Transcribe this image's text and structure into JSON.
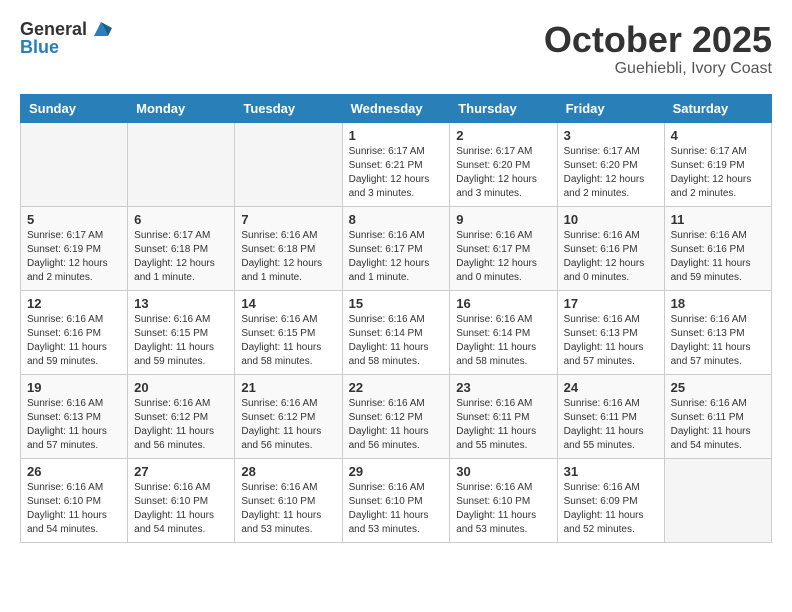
{
  "header": {
    "logo_general": "General",
    "logo_blue": "Blue",
    "month": "October 2025",
    "location": "Guehiebli, Ivory Coast"
  },
  "weekdays": [
    "Sunday",
    "Monday",
    "Tuesday",
    "Wednesday",
    "Thursday",
    "Friday",
    "Saturday"
  ],
  "weeks": [
    [
      {
        "day": "",
        "info": ""
      },
      {
        "day": "",
        "info": ""
      },
      {
        "day": "",
        "info": ""
      },
      {
        "day": "1",
        "info": "Sunrise: 6:17 AM\nSunset: 6:21 PM\nDaylight: 12 hours\nand 3 minutes."
      },
      {
        "day": "2",
        "info": "Sunrise: 6:17 AM\nSunset: 6:20 PM\nDaylight: 12 hours\nand 3 minutes."
      },
      {
        "day": "3",
        "info": "Sunrise: 6:17 AM\nSunset: 6:20 PM\nDaylight: 12 hours\nand 2 minutes."
      },
      {
        "day": "4",
        "info": "Sunrise: 6:17 AM\nSunset: 6:19 PM\nDaylight: 12 hours\nand 2 minutes."
      }
    ],
    [
      {
        "day": "5",
        "info": "Sunrise: 6:17 AM\nSunset: 6:19 PM\nDaylight: 12 hours\nand 2 minutes."
      },
      {
        "day": "6",
        "info": "Sunrise: 6:17 AM\nSunset: 6:18 PM\nDaylight: 12 hours\nand 1 minute."
      },
      {
        "day": "7",
        "info": "Sunrise: 6:16 AM\nSunset: 6:18 PM\nDaylight: 12 hours\nand 1 minute."
      },
      {
        "day": "8",
        "info": "Sunrise: 6:16 AM\nSunset: 6:17 PM\nDaylight: 12 hours\nand 1 minute."
      },
      {
        "day": "9",
        "info": "Sunrise: 6:16 AM\nSunset: 6:17 PM\nDaylight: 12 hours\nand 0 minutes."
      },
      {
        "day": "10",
        "info": "Sunrise: 6:16 AM\nSunset: 6:16 PM\nDaylight: 12 hours\nand 0 minutes."
      },
      {
        "day": "11",
        "info": "Sunrise: 6:16 AM\nSunset: 6:16 PM\nDaylight: 11 hours\nand 59 minutes."
      }
    ],
    [
      {
        "day": "12",
        "info": "Sunrise: 6:16 AM\nSunset: 6:16 PM\nDaylight: 11 hours\nand 59 minutes."
      },
      {
        "day": "13",
        "info": "Sunrise: 6:16 AM\nSunset: 6:15 PM\nDaylight: 11 hours\nand 59 minutes."
      },
      {
        "day": "14",
        "info": "Sunrise: 6:16 AM\nSunset: 6:15 PM\nDaylight: 11 hours\nand 58 minutes."
      },
      {
        "day": "15",
        "info": "Sunrise: 6:16 AM\nSunset: 6:14 PM\nDaylight: 11 hours\nand 58 minutes."
      },
      {
        "day": "16",
        "info": "Sunrise: 6:16 AM\nSunset: 6:14 PM\nDaylight: 11 hours\nand 58 minutes."
      },
      {
        "day": "17",
        "info": "Sunrise: 6:16 AM\nSunset: 6:13 PM\nDaylight: 11 hours\nand 57 minutes."
      },
      {
        "day": "18",
        "info": "Sunrise: 6:16 AM\nSunset: 6:13 PM\nDaylight: 11 hours\nand 57 minutes."
      }
    ],
    [
      {
        "day": "19",
        "info": "Sunrise: 6:16 AM\nSunset: 6:13 PM\nDaylight: 11 hours\nand 57 minutes."
      },
      {
        "day": "20",
        "info": "Sunrise: 6:16 AM\nSunset: 6:12 PM\nDaylight: 11 hours\nand 56 minutes."
      },
      {
        "day": "21",
        "info": "Sunrise: 6:16 AM\nSunset: 6:12 PM\nDaylight: 11 hours\nand 56 minutes."
      },
      {
        "day": "22",
        "info": "Sunrise: 6:16 AM\nSunset: 6:12 PM\nDaylight: 11 hours\nand 56 minutes."
      },
      {
        "day": "23",
        "info": "Sunrise: 6:16 AM\nSunset: 6:11 PM\nDaylight: 11 hours\nand 55 minutes."
      },
      {
        "day": "24",
        "info": "Sunrise: 6:16 AM\nSunset: 6:11 PM\nDaylight: 11 hours\nand 55 minutes."
      },
      {
        "day": "25",
        "info": "Sunrise: 6:16 AM\nSunset: 6:11 PM\nDaylight: 11 hours\nand 54 minutes."
      }
    ],
    [
      {
        "day": "26",
        "info": "Sunrise: 6:16 AM\nSunset: 6:10 PM\nDaylight: 11 hours\nand 54 minutes."
      },
      {
        "day": "27",
        "info": "Sunrise: 6:16 AM\nSunset: 6:10 PM\nDaylight: 11 hours\nand 54 minutes."
      },
      {
        "day": "28",
        "info": "Sunrise: 6:16 AM\nSunset: 6:10 PM\nDaylight: 11 hours\nand 53 minutes."
      },
      {
        "day": "29",
        "info": "Sunrise: 6:16 AM\nSunset: 6:10 PM\nDaylight: 11 hours\nand 53 minutes."
      },
      {
        "day": "30",
        "info": "Sunrise: 6:16 AM\nSunset: 6:10 PM\nDaylight: 11 hours\nand 53 minutes."
      },
      {
        "day": "31",
        "info": "Sunrise: 6:16 AM\nSunset: 6:09 PM\nDaylight: 11 hours\nand 52 minutes."
      },
      {
        "day": "",
        "info": ""
      }
    ]
  ]
}
